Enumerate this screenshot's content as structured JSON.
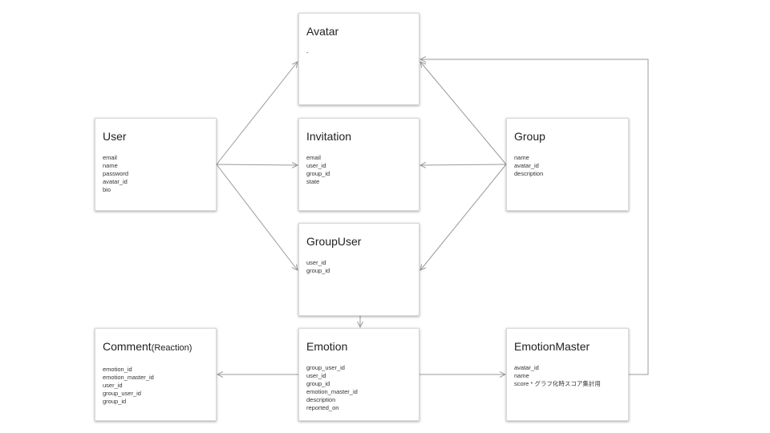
{
  "entities": {
    "avatar": {
      "title": "Avatar",
      "fields": [
        "-"
      ]
    },
    "user": {
      "title": "User",
      "fields": [
        "email",
        "name",
        "password",
        "avatar_id",
        "bio"
      ]
    },
    "invitation": {
      "title": "Invitation",
      "fields": [
        "email",
        "user_id",
        "group_id",
        "state"
      ]
    },
    "group": {
      "title": "Group",
      "fields": [
        "name",
        "avatar_id",
        "description"
      ]
    },
    "groupuser": {
      "title": "GroupUser",
      "fields": [
        "user_id",
        "group_id"
      ]
    },
    "comment": {
      "title": "Comment",
      "title_suffix": "(Reaction)",
      "fields": [
        "emotion_id",
        "emotion_master_id",
        "user_id",
        "group_user_id",
        "group_id"
      ]
    },
    "emotion": {
      "title": "Emotion",
      "fields": [
        "group_user_id",
        "user_id",
        "group_id",
        "emotion_master_id",
        "description",
        "reported_on"
      ]
    },
    "emotionmaster": {
      "title": "EmotionMaster",
      "fields": [
        "avatar_id",
        "name",
        "score * グラフ化時スコア集計用"
      ]
    }
  },
  "colors": {
    "edge": "#9a9a9a",
    "box_border": "#d8d8d8",
    "text": "#222222"
  }
}
